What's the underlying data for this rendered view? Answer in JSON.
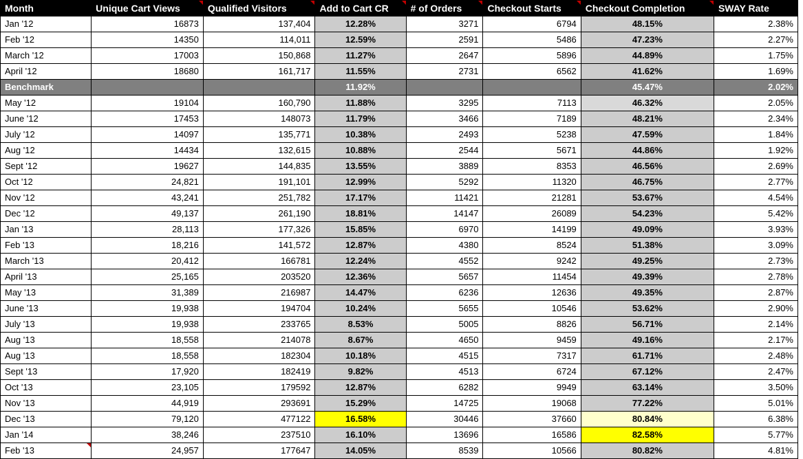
{
  "headers": [
    "Month",
    "Unique Cart Views",
    "Qualified Visitors",
    "Add to Cart CR",
    "# of Orders",
    "Checkout Starts",
    "Checkout Completion",
    "SWAY Rate"
  ],
  "header_indicators": [
    false,
    true,
    true,
    true,
    true,
    true,
    true,
    false
  ],
  "chart_data": {
    "type": "table",
    "columns": [
      "Month",
      "Unique Cart Views",
      "Qualified Visitors",
      "Add to Cart CR",
      "# of Orders",
      "Checkout Starts",
      "Checkout Completion",
      "SWAY Rate"
    ],
    "rows": [
      {
        "month": "Jan '12",
        "ucv": "16873",
        "qv": "137,404",
        "cr": "12.28%",
        "orders": "3271",
        "cs": "6794",
        "cc": "48.15%",
        "sway": "2.38%"
      },
      {
        "month": "Feb '12",
        "ucv": "14350",
        "qv": "114,011",
        "cr": "12.59%",
        "orders": "2591",
        "cs": "5486",
        "cc": "47.23%",
        "sway": "2.27%"
      },
      {
        "month": "March '12",
        "ucv": "17003",
        "qv": "150,868",
        "cr": "11.27%",
        "orders": "2647",
        "cs": "5896",
        "cc": "44.89%",
        "sway": "1.75%"
      },
      {
        "month": "April '12",
        "ucv": "18680",
        "qv": "161,717",
        "cr": "11.55%",
        "orders": "2731",
        "cs": "6562",
        "cc": "41.62%",
        "sway": "1.69%"
      },
      {
        "month": "Benchmark",
        "ucv": "",
        "qv": "",
        "cr": "11.92%",
        "orders": "",
        "cs": "",
        "cc": "45.47%",
        "sway": "2.02%",
        "benchmark": true
      },
      {
        "month": "May '12",
        "ucv": "19104",
        "qv": "160,790",
        "cr": "11.88%",
        "orders": "3295",
        "cs": "7113",
        "cc": "46.32%",
        "sway": "2.05%",
        "cc_light": true
      },
      {
        "month": "June '12",
        "ucv": "17453",
        "qv": "148073",
        "cr": "11.79%",
        "orders": "3466",
        "cs": "7189",
        "cc": "48.21%",
        "sway": "2.34%"
      },
      {
        "month": "July '12",
        "ucv": "14097",
        "qv": "135,771",
        "cr": "10.38%",
        "orders": "2493",
        "cs": "5238",
        "cc": "47.59%",
        "sway": "1.84%"
      },
      {
        "month": "Aug '12",
        "ucv": "14434",
        "qv": "132,615",
        "cr": "10.88%",
        "orders": "2544",
        "cs": "5671",
        "cc": "44.86%",
        "sway": "1.92%"
      },
      {
        "month": "Sept '12",
        "ucv": "19627",
        "qv": "144,835",
        "cr": "13.55%",
        "orders": "3889",
        "cs": "8353",
        "cc": "46.56%",
        "sway": "2.69%"
      },
      {
        "month": "Oct '12",
        "ucv": "24,821",
        "qv": "191,101",
        "cr": "12.99%",
        "orders": "5292",
        "cs": "11320",
        "cc": "46.75%",
        "sway": "2.77%"
      },
      {
        "month": "Nov '12",
        "ucv": "43,241",
        "qv": "251,782",
        "cr": "17.17%",
        "orders": "11421",
        "cs": "21281",
        "cc": "53.67%",
        "sway": "4.54%"
      },
      {
        "month": "Dec '12",
        "ucv": "49,137",
        "qv": "261,190",
        "cr": "18.81%",
        "orders": "14147",
        "cs": "26089",
        "cc": "54.23%",
        "sway": "5.42%"
      },
      {
        "month": "Jan '13",
        "ucv": "28,113",
        "qv": "177,326",
        "cr": "15.85%",
        "orders": "6970",
        "cs": "14199",
        "cc": "49.09%",
        "sway": "3.93%"
      },
      {
        "month": "Feb '13",
        "ucv": "18,216",
        "qv": "141,572",
        "cr": "12.87%",
        "orders": "4380",
        "cs": "8524",
        "cc": "51.38%",
        "sway": "3.09%"
      },
      {
        "month": "March '13",
        "ucv": "20,412",
        "qv": "166781",
        "cr": "12.24%",
        "orders": "4552",
        "cs": "9242",
        "cc": "49.25%",
        "sway": "2.73%"
      },
      {
        "month": "April '13",
        "ucv": "25,165",
        "qv": "203520",
        "cr": "12.36%",
        "orders": "5657",
        "cs": "11454",
        "cc": "49.39%",
        "sway": "2.78%"
      },
      {
        "month": "May '13",
        "ucv": "31,389",
        "qv": "216987",
        "cr": "14.47%",
        "orders": "6236",
        "cs": "12636",
        "cc": "49.35%",
        "sway": "2.87%"
      },
      {
        "month": "June '13",
        "ucv": "19,938",
        "qv": "194704",
        "cr": "10.24%",
        "orders": "5655",
        "cs": "10546",
        "cc": "53.62%",
        "sway": "2.90%"
      },
      {
        "month": "July '13",
        "ucv": "19,938",
        "qv": "233765",
        "cr": "8.53%",
        "orders": "5005",
        "cs": "8826",
        "cc": "56.71%",
        "sway": "2.14%"
      },
      {
        "month": "Aug '13",
        "ucv": "18,558",
        "qv": "214078",
        "cr": "8.67%",
        "orders": "4650",
        "cs": "9459",
        "cc": "49.16%",
        "sway": "2.17%"
      },
      {
        "month": "Aug '13",
        "ucv": "18,558",
        "qv": "182304",
        "cr": "10.18%",
        "orders": "4515",
        "cs": "7317",
        "cc": "61.71%",
        "sway": "2.48%"
      },
      {
        "month": "Sept '13",
        "ucv": "17,920",
        "qv": "182419",
        "cr": "9.82%",
        "orders": "4513",
        "cs": "6724",
        "cc": "67.12%",
        "sway": "2.47%"
      },
      {
        "month": "Oct '13",
        "ucv": "23,105",
        "qv": "179592",
        "cr": "12.87%",
        "orders": "6282",
        "cs": "9949",
        "cc": "63.14%",
        "sway": "3.50%"
      },
      {
        "month": "Nov '13",
        "ucv": "44,919",
        "qv": "293691",
        "cr": "15.29%",
        "orders": "14725",
        "cs": "19068",
        "cc": "77.22%",
        "sway": "5.01%"
      },
      {
        "month": "Dec '13",
        "ucv": "79,120",
        "qv": "477122",
        "cr": "16.58%",
        "orders": "30446",
        "cs": "37660",
        "cc": "80.84%",
        "sway": "6.38%",
        "cr_yellow": true,
        "cc_lightyellow": true
      },
      {
        "month": "Jan '14",
        "ucv": "38,246",
        "qv": "237510",
        "cr": "16.10%",
        "orders": "13696",
        "cs": "16586",
        "cc": "82.58%",
        "sway": "5.77%",
        "cc_yellow": true
      },
      {
        "month": "Feb '13",
        "ucv": "24,957",
        "qv": "177647",
        "cr": "14.05%",
        "orders": "8539",
        "cs": "10566",
        "cc": "80.82%",
        "sway": "4.81%",
        "month_ind": true
      }
    ]
  }
}
